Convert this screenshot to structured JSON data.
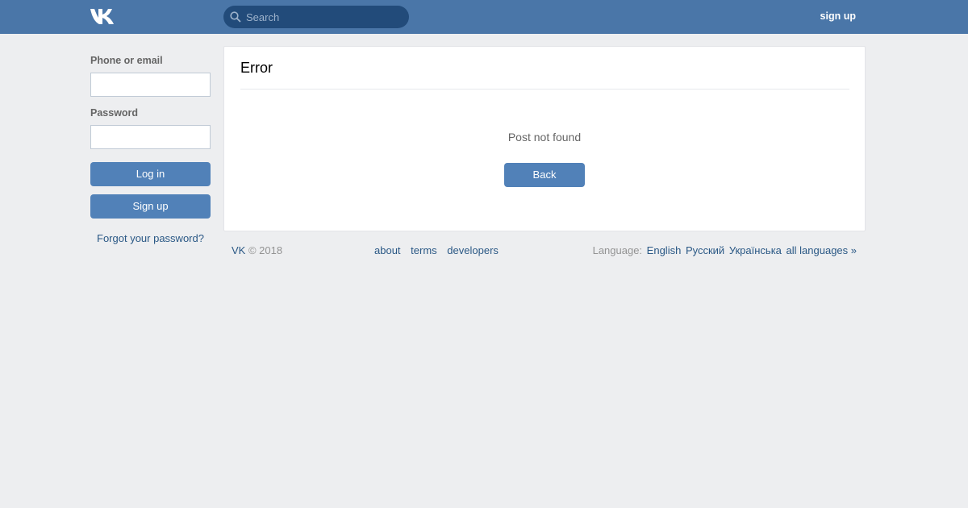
{
  "header": {
    "search_placeholder": "Search",
    "signup_label": "sign up",
    "logo_icon": "vk-logo-icon",
    "search_icon": "search-icon"
  },
  "sidebar": {
    "phone_label": "Phone or email",
    "password_label": "Password",
    "login_button": "Log in",
    "signup_button": "Sign up",
    "forgot_link": "Forgot your password?"
  },
  "content": {
    "title": "Error",
    "message": "Post not found",
    "back_button": "Back"
  },
  "footer": {
    "brand": "VK",
    "copyright": "© 2018",
    "links": [
      "about",
      "terms",
      "developers"
    ],
    "language_label": "Language:",
    "languages": [
      "English",
      "Русский",
      "Українська",
      "all languages »"
    ]
  },
  "colors": {
    "header_bg": "#4a76a8",
    "page_bg": "#edeef0",
    "button_bg": "#5181b8",
    "link": "#2a5885"
  }
}
